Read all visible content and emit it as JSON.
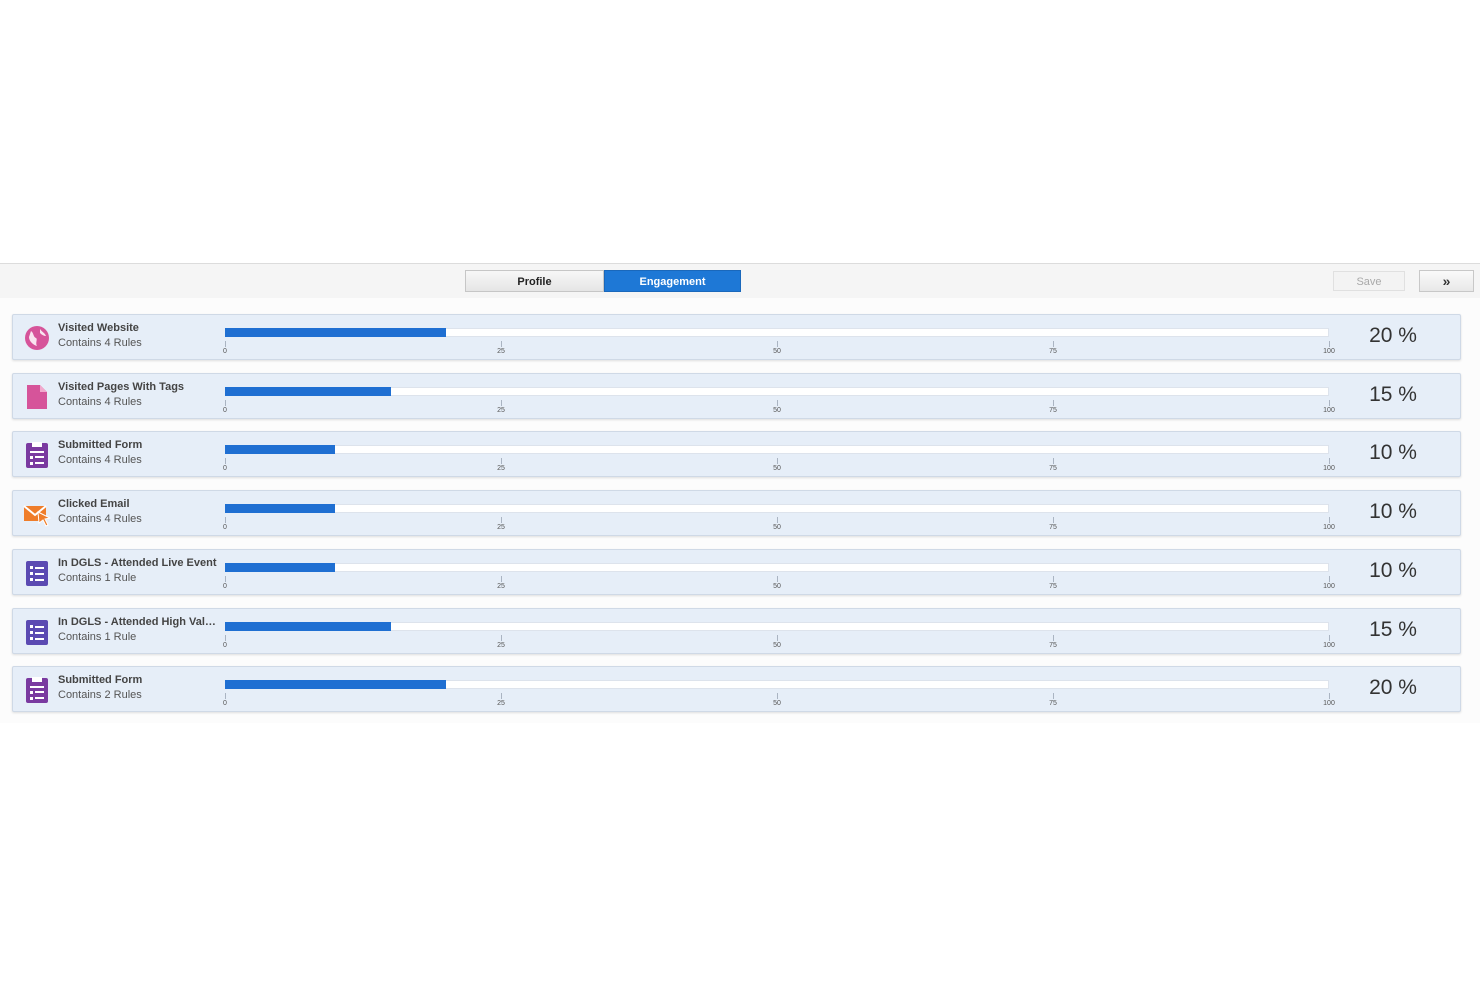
{
  "tabs": [
    {
      "label": "Profile",
      "active": false
    },
    {
      "label": "Engagement",
      "active": true
    }
  ],
  "actions": {
    "save_label": "Save",
    "collapse_icon": "double-chevron-right-icon",
    "collapse_glyph": "»"
  },
  "colors": {
    "accent": "#1e78d6",
    "bar": "#1f6fd2",
    "row_bg": "#e6eef8"
  },
  "scale_ticks": [
    "0",
    "25",
    "50",
    "75",
    "100"
  ],
  "rows": [
    {
      "title": "Visited Website",
      "subtitle": "Contains 4 Rules",
      "percent_label": "20 %",
      "value": 20,
      "icon": "globe-icon",
      "icon_color": "#d6549a"
    },
    {
      "title": "Visited Pages With Tags",
      "subtitle": "Contains 4 Rules",
      "percent_label": "15 %",
      "value": 15,
      "icon": "page-icon",
      "icon_color": "#d6549a"
    },
    {
      "title": "Submitted Form",
      "subtitle": "Contains 4 Rules",
      "percent_label": "10 %",
      "value": 10,
      "icon": "form-icon",
      "icon_color": "#7a3aa0"
    },
    {
      "title": "Clicked Email",
      "subtitle": "Contains 4 Rules",
      "percent_label": "10 %",
      "value": 10,
      "icon": "email-click-icon",
      "icon_color": "#ef7d2a"
    },
    {
      "title": "In DGLS - Attended Live Event",
      "subtitle": "Contains 1 Rule",
      "percent_label": "10 %",
      "value": 10,
      "icon": "list-icon",
      "icon_color": "#5b4ab2"
    },
    {
      "title": "In DGLS - Attended High Valu...",
      "subtitle": "Contains 1 Rule",
      "percent_label": "15 %",
      "value": 15,
      "icon": "list-icon",
      "icon_color": "#5b4ab2"
    },
    {
      "title": "Submitted Form",
      "subtitle": "Contains 2 Rules",
      "percent_label": "20 %",
      "value": 20,
      "icon": "form-icon",
      "icon_color": "#7a3aa0"
    }
  ]
}
